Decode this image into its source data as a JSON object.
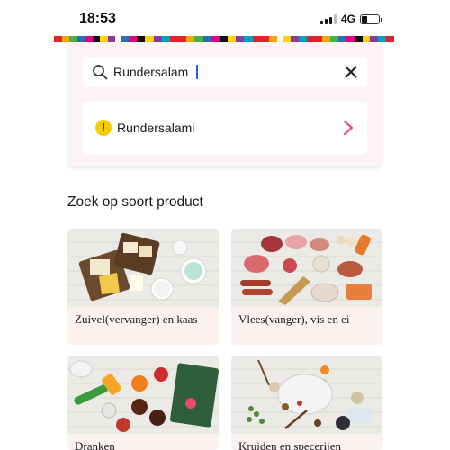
{
  "status_bar": {
    "time": "18:53",
    "network": "4G",
    "battery_level": 0.35
  },
  "brand_stripe_colors": [
    "#e3222b",
    "#f7a800",
    "#4bb043",
    "#2d6db5",
    "#e6007e",
    "#111111",
    "#ffd200",
    "#8a3c9b",
    "#00a0c6",
    "#e3222b"
  ],
  "search": {
    "value": "Rundersalam",
    "placeholder": "",
    "search_icon": "search-icon",
    "clear_icon": "close-icon"
  },
  "suggestion": {
    "label": "Rundersalami",
    "status_icon": "warning-icon",
    "status_color": "#f5cc00",
    "chevron_color": "#e0567a"
  },
  "section": {
    "title": "Zoek op soort product"
  },
  "categories": [
    {
      "label": "Zuivel(vervanger) en kaas",
      "image": "dairy-cheese-photo"
    },
    {
      "label": "Vlees(vanger), vis en ei",
      "image": "meat-fish-egg-photo"
    },
    {
      "label": "Dranken",
      "image": "drinks-photo"
    },
    {
      "label": "Kruiden en specerijen",
      "image": "herbs-spices-photo"
    }
  ]
}
